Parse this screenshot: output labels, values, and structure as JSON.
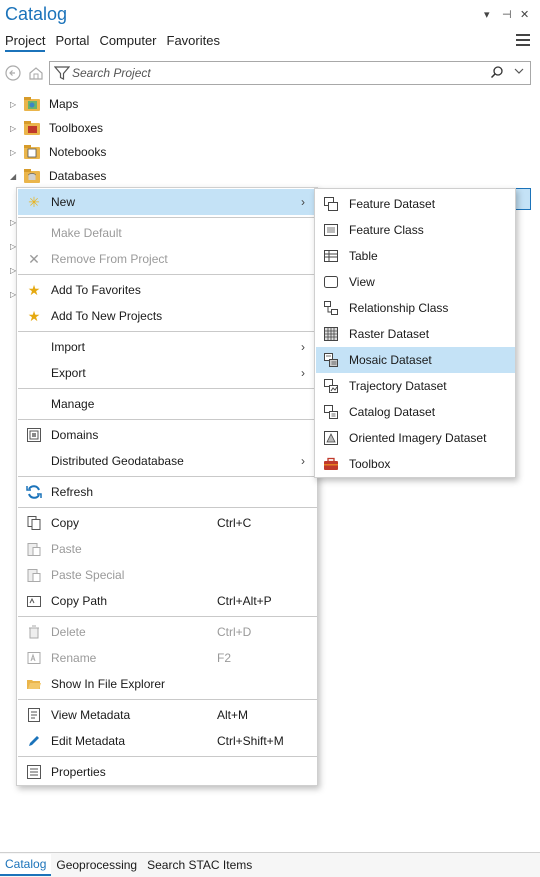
{
  "pane": {
    "title": "Catalog",
    "dropdown_glyph": "▾",
    "pin_glyph": "⊣",
    "close_glyph": "✕"
  },
  "tabs": [
    {
      "label": "Project",
      "active": true
    },
    {
      "label": "Portal"
    },
    {
      "label": "Computer"
    },
    {
      "label": "Favorites"
    }
  ],
  "search": {
    "placeholder": "Search Project"
  },
  "tree": [
    {
      "label": "Maps",
      "icon": "folder-maps-icon",
      "color": "#e9a93a"
    },
    {
      "label": "Toolboxes",
      "icon": "folder-toolboxes-icon",
      "color": "#e9a93a"
    },
    {
      "label": "Notebooks",
      "icon": "folder-notebooks-icon",
      "color": "#e9a93a"
    },
    {
      "label": "Databases",
      "icon": "folder-databases-icon",
      "color": "#e9a93a"
    }
  ],
  "context_menu": {
    "new": "New",
    "make_default": "Make Default",
    "remove_from_project": "Remove From Project",
    "add_to_favorites": "Add To Favorites",
    "add_to_new_projects": "Add To New Projects",
    "import": "Import",
    "export": "Export",
    "manage": "Manage",
    "domains": "Domains",
    "distributed_geodatabase": "Distributed Geodatabase",
    "refresh": "Refresh",
    "copy": "Copy",
    "copy_shortcut": "Ctrl+C",
    "paste": "Paste",
    "paste_special": "Paste Special",
    "copy_path": "Copy Path",
    "copy_path_shortcut": "Ctrl+Alt+P",
    "delete": "Delete",
    "delete_shortcut": "Ctrl+D",
    "rename": "Rename",
    "rename_shortcut": "F2",
    "show_in_file_explorer": "Show In File Explorer",
    "view_metadata": "View Metadata",
    "view_metadata_shortcut": "Alt+M",
    "edit_metadata": "Edit Metadata",
    "edit_metadata_shortcut": "Ctrl+Shift+M",
    "properties": "Properties",
    "submenu_arrow": "›"
  },
  "new_submenu": [
    {
      "label": "Feature Dataset",
      "icon": "feature-dataset-icon"
    },
    {
      "label": "Feature Class",
      "icon": "feature-class-icon"
    },
    {
      "label": "Table",
      "icon": "table-icon"
    },
    {
      "label": "View",
      "icon": "view-icon"
    },
    {
      "label": "Relationship Class",
      "icon": "relationship-class-icon"
    },
    {
      "label": "Raster Dataset",
      "icon": "raster-dataset-icon"
    },
    {
      "label": "Mosaic Dataset",
      "icon": "mosaic-dataset-icon",
      "highlighted": true
    },
    {
      "label": "Trajectory Dataset",
      "icon": "trajectory-dataset-icon"
    },
    {
      "label": "Catalog Dataset",
      "icon": "catalog-dataset-icon"
    },
    {
      "label": "Oriented Imagery Dataset",
      "icon": "oriented-imagery-dataset-icon"
    },
    {
      "label": "Toolbox",
      "icon": "toolbox-icon"
    }
  ],
  "bottom_tabs": [
    {
      "label": "Catalog",
      "active": true
    },
    {
      "label": "Geoprocessing"
    },
    {
      "label": "Search STAC Items"
    }
  ],
  "colors": {
    "accent": "#1b73ba",
    "highlight": "#c4e2f6",
    "disabled": "#9a9a9a"
  }
}
